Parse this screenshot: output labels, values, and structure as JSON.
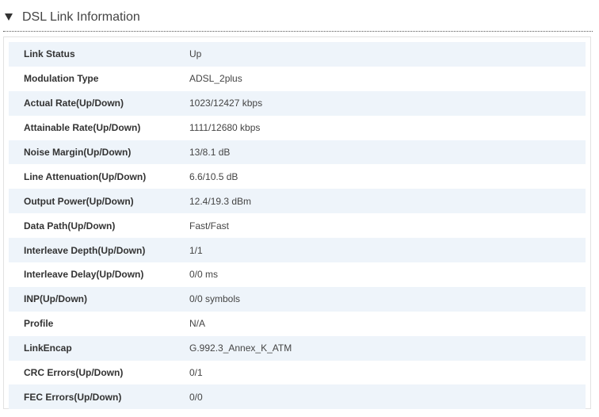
{
  "section": {
    "title": "DSL Link Information"
  },
  "rows": [
    {
      "label": "Link Status",
      "value": "Up"
    },
    {
      "label": "Modulation Type",
      "value": "ADSL_2plus"
    },
    {
      "label": "Actual Rate(Up/Down)",
      "value": "1023/12427 kbps"
    },
    {
      "label": "Attainable Rate(Up/Down)",
      "value": "1111/12680 kbps"
    },
    {
      "label": "Noise Margin(Up/Down)",
      "value": "13/8.1 dB"
    },
    {
      "label": "Line Attenuation(Up/Down)",
      "value": "6.6/10.5 dB"
    },
    {
      "label": "Output Power(Up/Down)",
      "value": "12.4/19.3 dBm"
    },
    {
      "label": "Data Path(Up/Down)",
      "value": "Fast/Fast"
    },
    {
      "label": "Interleave Depth(Up/Down)",
      "value": "1/1"
    },
    {
      "label": "Interleave Delay(Up/Down)",
      "value": "0/0 ms"
    },
    {
      "label": "INP(Up/Down)",
      "value": "0/0 symbols"
    },
    {
      "label": "Profile",
      "value": "N/A"
    },
    {
      "label": "LinkEncap",
      "value": "G.992.3_Annex_K_ATM"
    },
    {
      "label": "CRC Errors(Up/Down)",
      "value": "0/1"
    },
    {
      "label": "FEC Errors(Up/Down)",
      "value": "0/0"
    }
  ],
  "icons": {
    "toggle": "collapse-triangle-icon"
  }
}
